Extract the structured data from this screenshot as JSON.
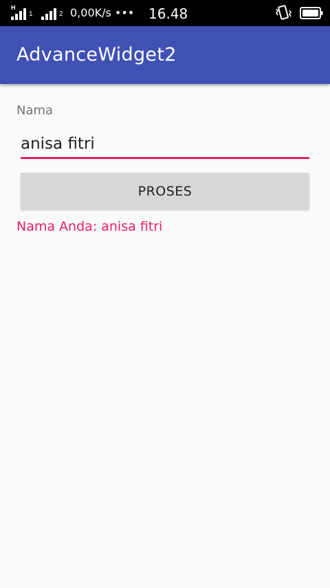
{
  "status_bar": {
    "sim1_type": "H",
    "sim1_number": "1",
    "sim2_number": "2",
    "net_speed": "0,00K/s •••",
    "time": "16.48",
    "icons": [
      "signal-icon",
      "signal-icon",
      "vibrate-icon",
      "battery-icon"
    ]
  },
  "app_bar": {
    "title": "AdvanceWidget2",
    "color": "#3f51b5"
  },
  "form": {
    "label": "Nama",
    "input_value": "anisa fitri",
    "button_label": "PROSES",
    "result": "Nama Anda: anisa fitri",
    "accent_color": "#e91e63"
  }
}
